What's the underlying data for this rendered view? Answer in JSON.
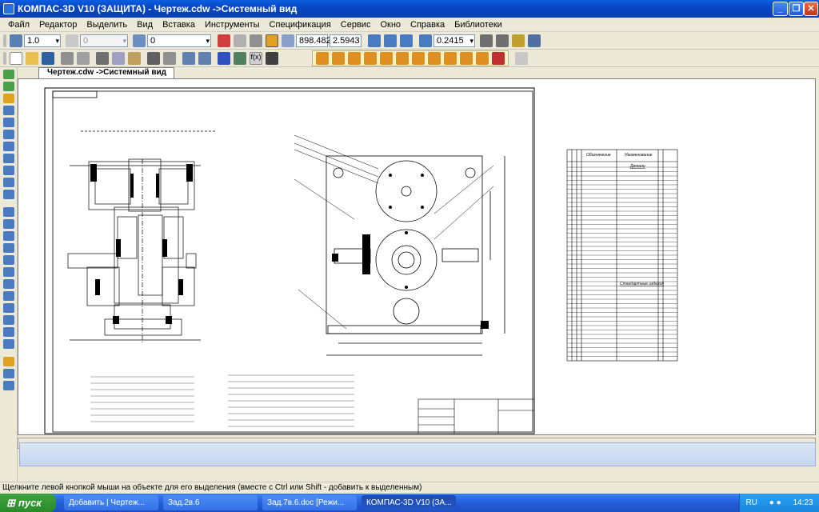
{
  "window": {
    "title": "КОМПАС-3D V10 (ЗАЩИТА) - Чертеж.cdw ->Системный вид"
  },
  "menu": [
    "Файл",
    "Редактор",
    "Выделить",
    "Вид",
    "Вставка",
    "Инструменты",
    "Спецификация",
    "Сервис",
    "Окно",
    "Справка",
    "Библиотеки"
  ],
  "toolbar": {
    "line_scale": "1.0",
    "layer_state": "0",
    "layer_number": "0",
    "coord_x": "898.482",
    "coord_y": "2.5943",
    "zoom": "0.2415"
  },
  "document": {
    "tab_label": "Чертеж.cdw ->Системный вид"
  },
  "spec_table": {
    "col_headers": [
      "Обозначение",
      "Наименование"
    ],
    "section": "Детали",
    "purchased_section": "Стандартные изделия"
  },
  "status": {
    "hint": "Щелкните левой кнопкой мыши на объекте для его выделения (вместе с Ctrl или Shift - добавить к выделенным)"
  },
  "taskbar": {
    "start": "пуск",
    "tasks": [
      "Добавить | Чертеж...",
      "Зад.2в.6",
      "Зад.7в.6.doc [Режи...",
      "КОМПАС-3D V10 (ЗА..."
    ],
    "lang": "RU",
    "clock": "14:23"
  },
  "icons": [
    "kompas-app-icon",
    "minimize-icon",
    "maximize-icon",
    "close-icon",
    "start-icon"
  ]
}
